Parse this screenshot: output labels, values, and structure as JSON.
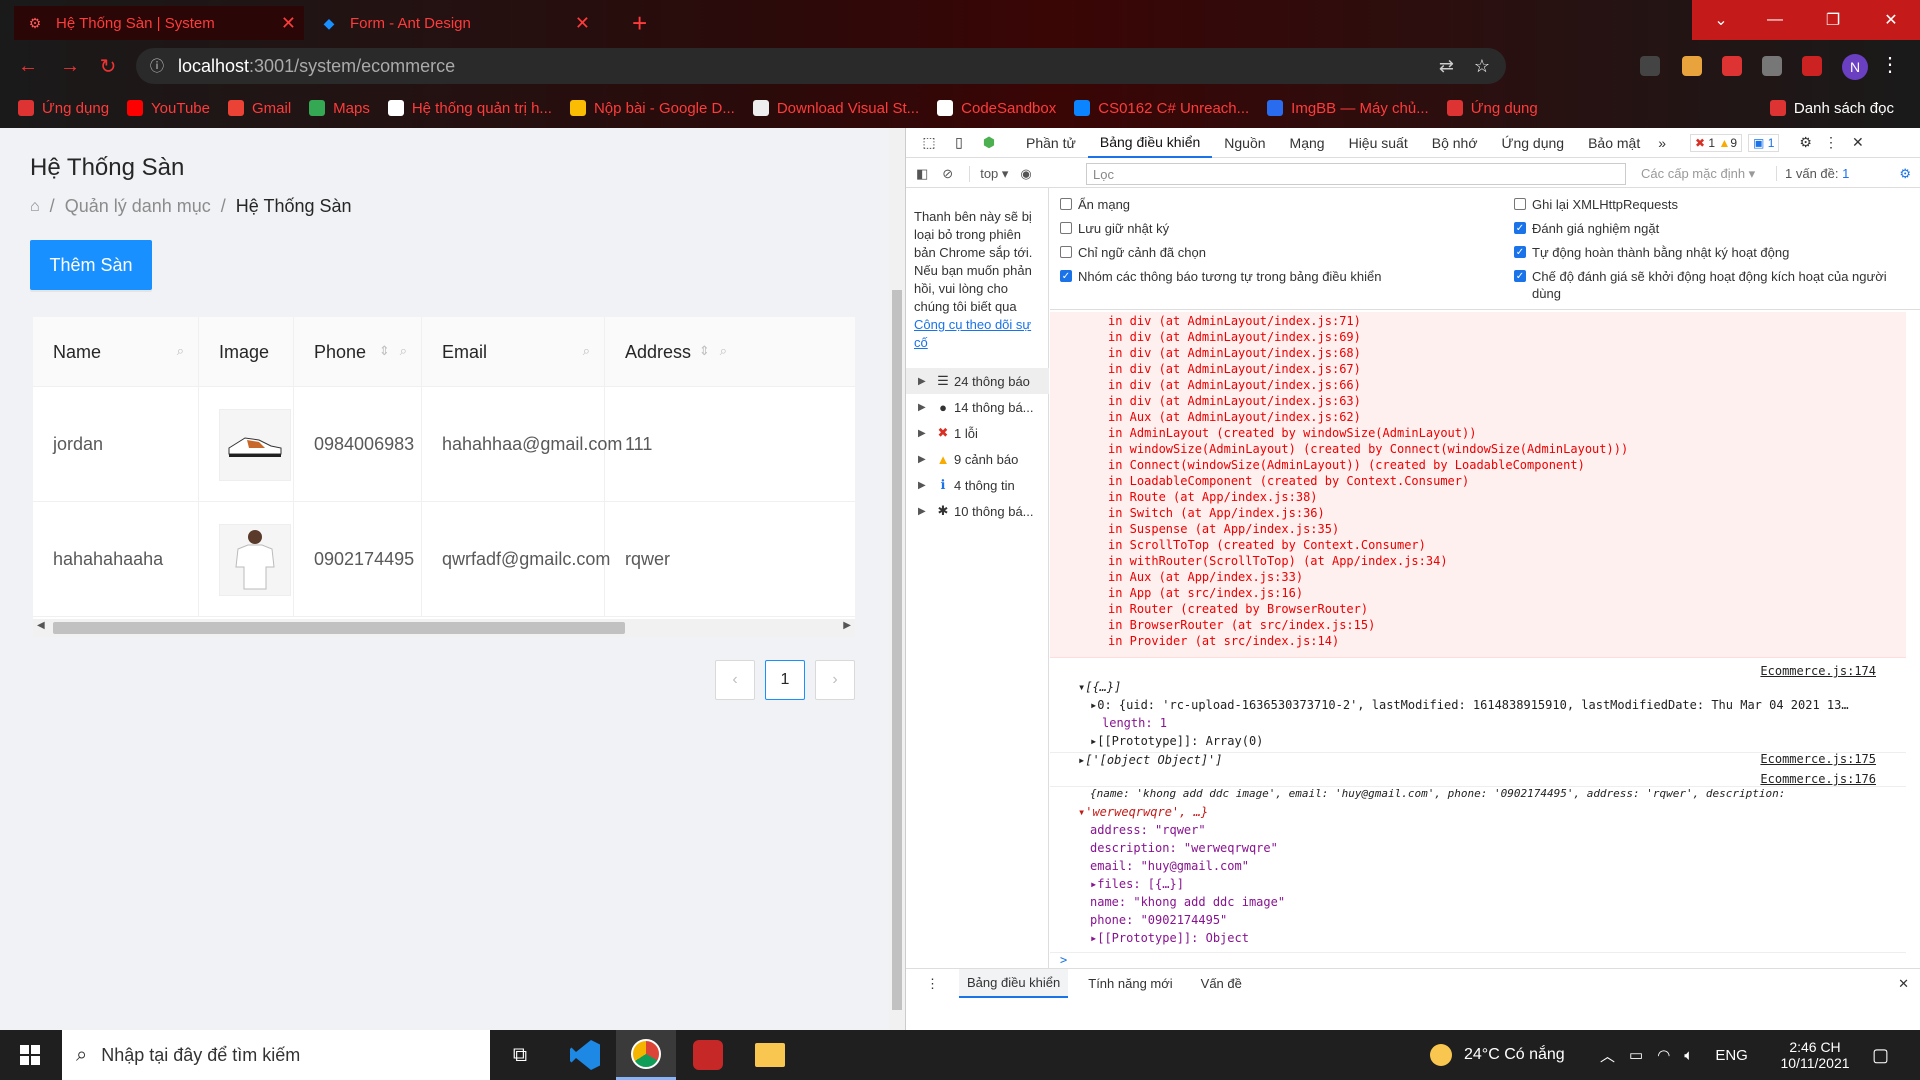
{
  "browser": {
    "tabs": [
      {
        "title": "Hệ Thống Sàn | System"
      },
      {
        "title": "Form - Ant Design"
      }
    ],
    "url_host": "localhost",
    "url_rest": ":3001/system/ecommerce",
    "bookmarks": [
      "Ứng dụng",
      "YouTube",
      "Gmail",
      "Maps",
      "Hệ thống quản trị h...",
      "Nộp bài - Google D...",
      "Download Visual St...",
      "CodeSandbox",
      "CS0162 C# Unreach...",
      "ImgBB — Máy chủ...",
      "Ứng dụng"
    ],
    "reading_list": "Danh sách đọc",
    "avatar": "N"
  },
  "page": {
    "title": "Hệ Thống Sàn",
    "breadcrumb": {
      "parent": "Quản lý danh mục",
      "current": "Hệ Thống Sàn",
      "sep": "/"
    },
    "add_button": "Thêm Sàn",
    "columns": [
      "Name",
      "Image",
      "Phone",
      "Email",
      "Address"
    ],
    "rows": [
      {
        "name": "jordan",
        "phone": "0984006983",
        "email": "hahahhaa@gmail.com",
        "address": "111"
      },
      {
        "name": "hahahahaaha",
        "phone": "0902174495",
        "email": "qwrfadf@gmailc.com",
        "address": "rqwer"
      }
    ],
    "pagination": {
      "current": "1",
      "prev": "‹",
      "next": "›"
    }
  },
  "devtools": {
    "tabs": [
      "Phần tử",
      "Bảng điều khiển",
      "Nguồn",
      "Mạng",
      "Hiệu suất",
      "Bộ nhớ",
      "Ứng dụng",
      "Bảo mật"
    ],
    "badges": {
      "errors": "1",
      "warnings": "9",
      "info": "1"
    },
    "context": "top",
    "filter_placeholder": "Lọc",
    "levels": "Các cấp mặc định",
    "issues": "1 vấn đề:",
    "issues_count": "1",
    "side_note": "Thanh bên này sẽ bị loại bỏ trong phiên bản Chrome sắp tới. Nếu bạn muốn phản hồi, vui lòng cho chúng tôi biết qua",
    "side_link": "Công cụ theo dõi sự cố",
    "side_items": [
      {
        "icon": "list-icon",
        "glyph": "☰",
        "label": "24 thông báo"
      },
      {
        "icon": "user-icon",
        "glyph": "●",
        "label": "14 thông bá..."
      },
      {
        "icon": "error-icon",
        "glyph": "✖",
        "label": "1 lỗi"
      },
      {
        "icon": "warning-icon",
        "glyph": "▲",
        "label": "9 cảnh báo"
      },
      {
        "icon": "info-icon",
        "glyph": "ℹ",
        "label": "4 thông tin"
      },
      {
        "icon": "bug-icon",
        "glyph": "✱",
        "label": "10 thông bá..."
      }
    ],
    "options_left": [
      {
        "label": "Ẩn mạng",
        "checked": false
      },
      {
        "label": "Lưu giữ nhật ký",
        "checked": false
      },
      {
        "label": "Chỉ ngữ cảnh đã chọn",
        "checked": false
      },
      {
        "label": "Nhóm các thông báo tương tự trong bảng điều khiển",
        "checked": true
      }
    ],
    "options_right": [
      {
        "label": "Ghi lại XMLHttpRequests",
        "checked": false
      },
      {
        "label": "Đánh giá nghiệm ngặt",
        "checked": true
      },
      {
        "label": "Tự động hoàn thành bằng nhật ký hoạt động",
        "checked": true
      },
      {
        "label": "Chế độ đánh giá sẽ khởi động hoạt động kích hoạt của người dùng",
        "checked": true
      }
    ],
    "error_lines": [
      "in div (at AdminLayout/index.js:71)",
      "in div (at AdminLayout/index.js:69)",
      "in div (at AdminLayout/index.js:68)",
      "in div (at AdminLayout/index.js:67)",
      "in div (at AdminLayout/index.js:66)",
      "in div (at AdminLayout/index.js:63)",
      "in Aux (at AdminLayout/index.js:62)",
      "in AdminLayout (created by windowSize(AdminLayout))",
      "in windowSize(AdminLayout) (created by Connect(windowSize(AdminLayout)))",
      "in Connect(windowSize(AdminLayout)) (created by LoadableComponent)",
      "in LoadableComponent (created by Context.Consumer)",
      "in Route (at App/index.js:38)",
      "in Switch (at App/index.js:36)",
      "in Suspense (at App/index.js:35)",
      "in ScrollToTop (created by Context.Consumer)",
      "in withRouter(ScrollToTop) (at App/index.js:34)",
      "in Aux (at App/index.js:33)",
      "in App (at src/index.js:16)",
      "in Router (created by BrowserRouter)",
      "in BrowserRouter (at src/index.js:15)",
      "in Provider (at src/index.js:14)"
    ],
    "logs": {
      "src1": "Ecommerce.js:174",
      "l1": "▾[{…}]",
      "l1a": "▸0: {uid: 'rc-upload-1636530373710-2', lastModified: 1614838915910, lastModifiedDate: Thu Mar 04 2021 13…",
      "l1b": "length: 1",
      "l1c": "▸[[Prototype]]: Array(0)",
      "src2": "Ecommerce.js:175",
      "l2": "▸['[object Object]']",
      "src3": "Ecommerce.js:176",
      "l3": "{name: 'khong add ddc image', email: 'huy@gmail.com', phone: '0902174495', address: 'rqwer', description:",
      "l3b": "▾'werweqrwqre', …}",
      "props": [
        "address: \"rqwer\"",
        "description: \"werweqrwqre\"",
        "email: \"huy@gmail.com\"",
        "▸files: [{…}]",
        "name: \"khong add ddc image\"",
        "phone: \"0902174495\"",
        "▸[[Prototype]]: Object"
      ],
      "prompt": ">"
    },
    "footer_tabs": [
      "Bảng điều khiển",
      "Tính năng mới",
      "Vấn đề"
    ]
  },
  "taskbar": {
    "search_placeholder": "Nhập tại đây để tìm kiếm",
    "weather": "24°C  Có nắng",
    "lang": "ENG",
    "time": "2:46 CH",
    "date": "10/11/2021"
  }
}
